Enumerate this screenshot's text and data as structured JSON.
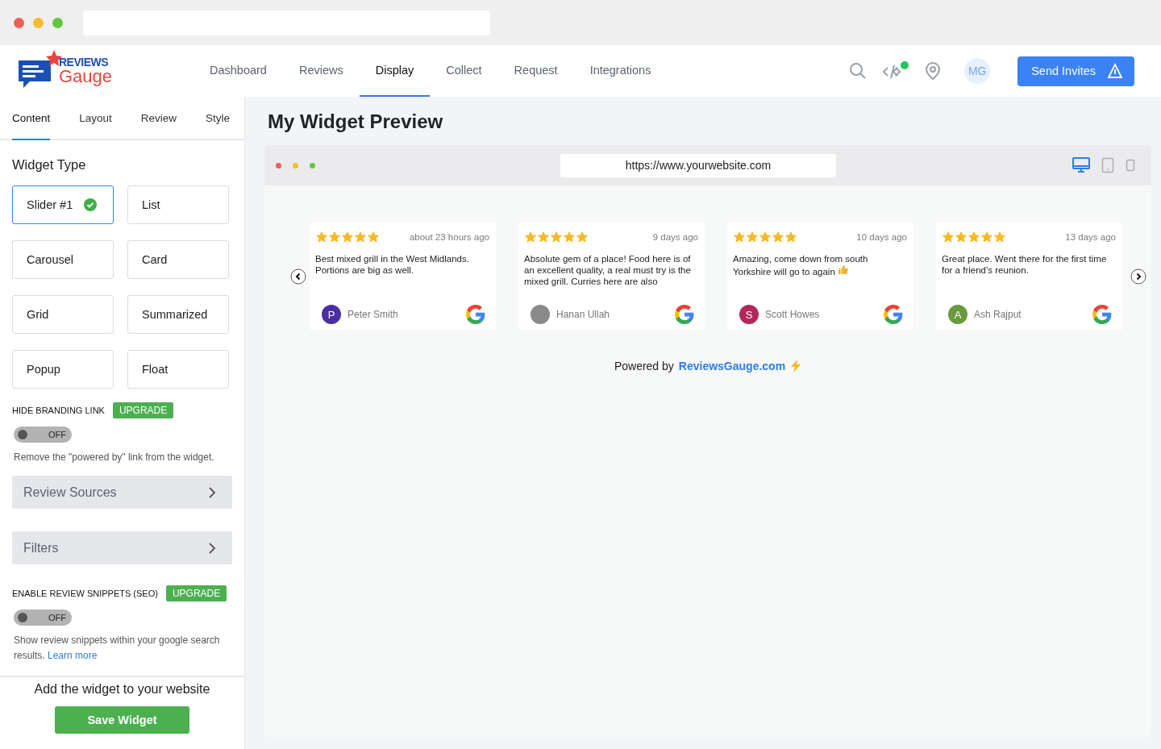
{
  "nav": {
    "brand_top": "REVIEWS",
    "brand_bottom": "Gauge",
    "items": [
      {
        "label": "Dashboard",
        "selected": false
      },
      {
        "label": "Reviews",
        "selected": false
      },
      {
        "label": "Display",
        "selected": true
      },
      {
        "label": "Collect",
        "selected": false
      },
      {
        "label": "Request",
        "selected": false
      },
      {
        "label": "Integrations",
        "selected": false
      }
    ],
    "avatar": "MG",
    "cta": "Send Invites"
  },
  "sidebar": {
    "tabs": [
      {
        "label": "Content",
        "selected": true
      },
      {
        "label": "Layout",
        "selected": false
      },
      {
        "label": "Review",
        "selected": false
      },
      {
        "label": "Style",
        "selected": false
      }
    ],
    "widget_type_title": "Widget Type",
    "widget_types": [
      {
        "label": "Slider #1",
        "selected": true
      },
      {
        "label": "List",
        "selected": false
      },
      {
        "label": "Carousel",
        "selected": false
      },
      {
        "label": "Card",
        "selected": false
      },
      {
        "label": "Grid",
        "selected": false
      },
      {
        "label": "Summarized",
        "selected": false
      },
      {
        "label": "Popup",
        "selected": false
      },
      {
        "label": "Float",
        "selected": false
      }
    ],
    "branding": {
      "label": "HIDE BRANDING LINK",
      "badge": "UPGRADE",
      "on": false,
      "state": "OFF",
      "help": "Remove the \"powered by\" link from the widget."
    },
    "sections": [
      "Review Sources",
      "Filters"
    ],
    "snippets": {
      "label": "ENABLE REVIEW SNIPPETS (SEO)",
      "badge": "UPGRADE",
      "on": false,
      "state": "OFF",
      "help": "Show review snippets within your google search results.",
      "link": "Learn more"
    },
    "footer_title": "Add the widget to your website",
    "save": "Save Widget"
  },
  "preview": {
    "title": "My Widget Preview",
    "url": "https://www.yourwebsite.com",
    "devices": [
      {
        "kind": "desktop",
        "selected": true
      },
      {
        "kind": "tablet",
        "selected": false
      },
      {
        "kind": "phone",
        "selected": false
      }
    ],
    "reviews": [
      {
        "stars": 5,
        "time": "about 23 hours ago",
        "text": "Best mixed grill in the West Midlands. Portions are big as well.",
        "thumbs": false,
        "avatar": "P",
        "photo": false,
        "color": "#4a2fa3",
        "author": "Peter Smith"
      },
      {
        "stars": 5,
        "time": "9 days ago",
        "text": "Absolute gem of a place! Food here is of an excellent quality, a real must try is the mixed grill. Curries here are also",
        "thumbs": false,
        "photo": true,
        "author": "Hanan Ullah"
      },
      {
        "stars": 5,
        "time": "10 days ago",
        "text": "Amazing, come down from south Yorkshire will go to again",
        "thumbs": true,
        "avatar": "S",
        "photo": false,
        "color": "#b0285a",
        "author": "Scott Howes"
      },
      {
        "stars": 5,
        "time": "13 days ago",
        "text": "Great place. Went there for the first time for a friend’s reunion.",
        "thumbs": false,
        "avatar": "A",
        "photo": false,
        "color": "#6a9a3e",
        "author": "Ash Rajput"
      }
    ],
    "powered_by": "Powered by",
    "powered_link": "ReviewsGauge.com"
  }
}
